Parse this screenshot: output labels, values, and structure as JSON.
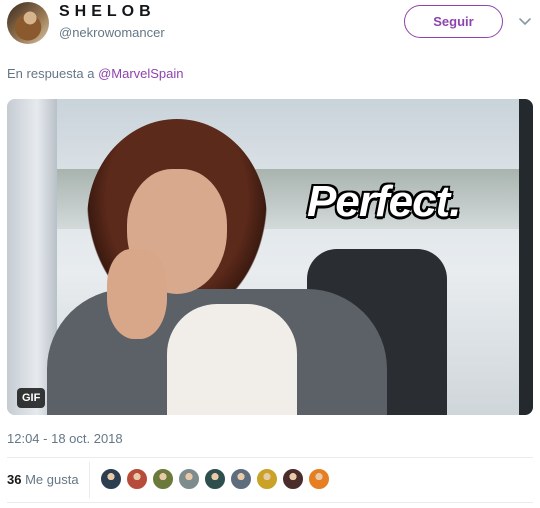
{
  "user": {
    "display_name": "SHELOB",
    "handle": "@nekrowomancer"
  },
  "follow_button": {
    "label": "Seguir"
  },
  "reply": {
    "prefix": "En respuesta a ",
    "mention": "@MarvelSpain"
  },
  "media": {
    "caption": "Perfect.",
    "badge": "GIF"
  },
  "timestamp": "12:04 - 18 oct. 2018",
  "likes": {
    "count": "36",
    "label": "Me gusta",
    "liker_avatar_colors": [
      "#2c3e50",
      "#b84c3a",
      "#6b7a3a",
      "#7f8c8d",
      "#2f4f4f",
      "#5d6d7e",
      "#c9a227",
      "#4a2c2a",
      "#e67e22"
    ]
  },
  "colors": {
    "accent": "#8e44ad",
    "secondary_text": "#657786",
    "primary_text": "#14171a"
  }
}
